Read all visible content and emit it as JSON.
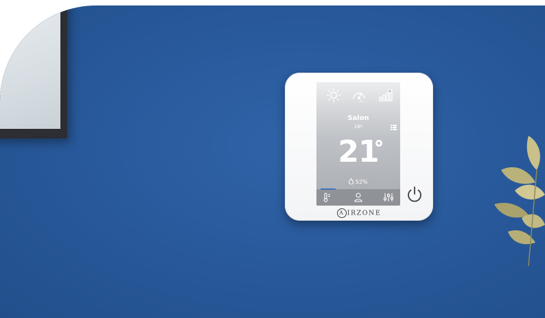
{
  "thermostat": {
    "zone_name": "Salon",
    "setpoint": "18º",
    "temperature": "21",
    "humidity": "52%",
    "brand_initial": "A",
    "brand_rest": "IRZONE"
  },
  "icons": {
    "top": [
      "sun-icon",
      "eco-gauge-icon",
      "signal-bars-icon"
    ],
    "side": [
      "list-icon"
    ],
    "bottom": [
      "thermometer-icon",
      "user-icon",
      "sliders-icon"
    ],
    "power": "power-icon"
  },
  "colors": {
    "wall": "#2a5c9f",
    "device": "#ffffff",
    "active_tab": "#2f6fd1"
  }
}
